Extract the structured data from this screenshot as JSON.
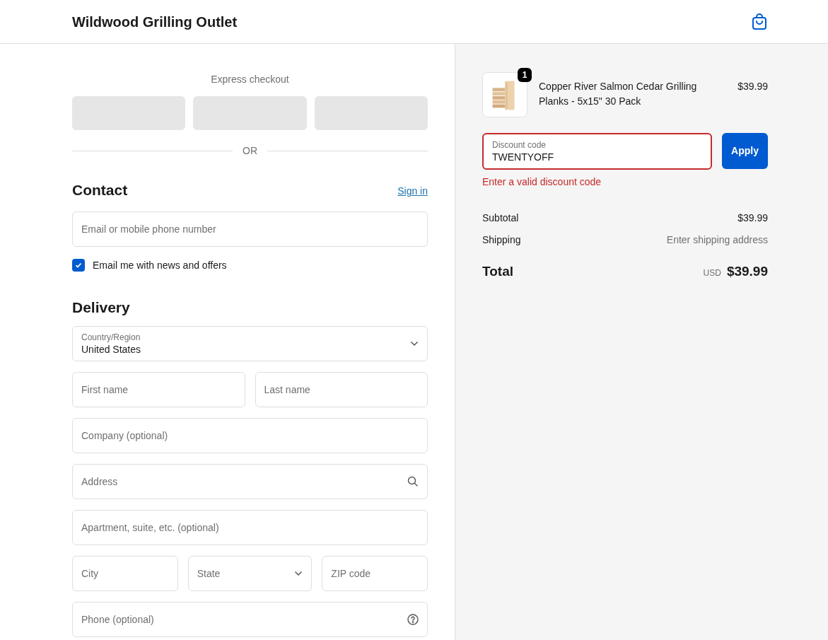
{
  "header": {
    "store_name": "Wildwood Grilling Outlet"
  },
  "express_checkout": {
    "label": "Express checkout",
    "divider": "OR"
  },
  "contact": {
    "heading": "Contact",
    "sign_in": "Sign in",
    "email": {
      "placeholder": "Email or mobile phone number"
    },
    "newsletter": {
      "label": "Email me with news and offers",
      "checked": true
    }
  },
  "delivery": {
    "heading": "Delivery",
    "rows": [
      [
        {
          "kind": "select",
          "label": "Country/Region",
          "value": "United States"
        }
      ],
      [
        {
          "kind": "text",
          "placeholder": "First name"
        },
        {
          "kind": "text",
          "placeholder": "Last name"
        }
      ],
      [
        {
          "kind": "text",
          "placeholder": "Company (optional)"
        }
      ],
      [
        {
          "kind": "address",
          "placeholder": "Address"
        }
      ],
      [
        {
          "kind": "text",
          "placeholder": "Apartment, suite, etc. (optional)"
        }
      ],
      [
        {
          "kind": "text",
          "placeholder": "City"
        },
        {
          "kind": "dropdown",
          "placeholder": "State"
        },
        {
          "kind": "text",
          "placeholder": "ZIP code"
        }
      ],
      [
        {
          "kind": "phone",
          "placeholder": "Phone (optional)"
        }
      ]
    ]
  },
  "order": {
    "product": {
      "name": "Copper River Salmon Cedar Grilling Planks - 5x15\" 30 Pack",
      "price": "$39.99",
      "quantity": "1"
    },
    "discount": {
      "label": "Discount code",
      "value": "TWENTYOFF",
      "invalid": true,
      "error": "Enter a valid discount code",
      "button": "Apply"
    },
    "summary": [
      {
        "label": "Subtotal",
        "value": "$39.99",
        "muted": false
      },
      {
        "label": "Shipping",
        "value": "Enter shipping address",
        "muted": true
      }
    ],
    "total": {
      "label": "Total",
      "currency": "USD",
      "amount": "$39.99"
    }
  }
}
